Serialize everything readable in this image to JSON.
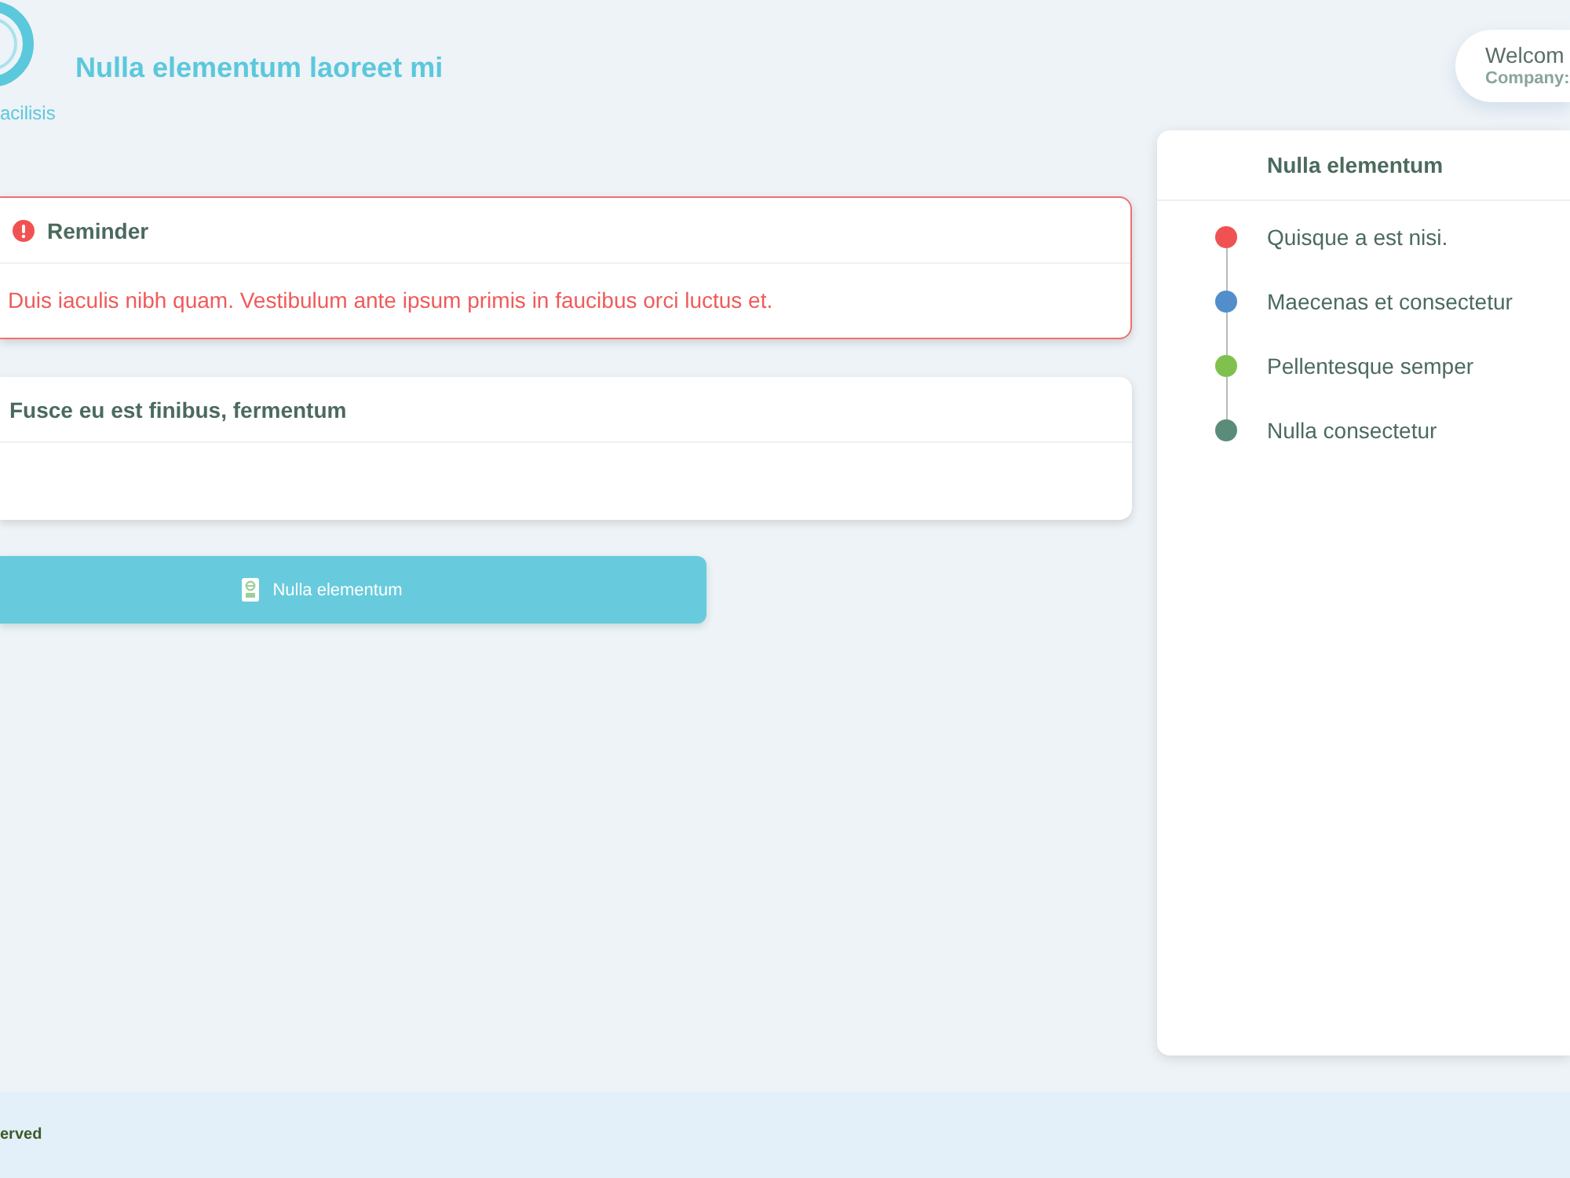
{
  "header": {
    "logo_caption": "acilisis",
    "title": "Nulla elementum laoreet mi",
    "user": {
      "greeting": "Welcom",
      "company": "Company:"
    }
  },
  "cards": [
    {
      "kind": "alert",
      "title": "Reminder",
      "body": "Duis iaculis nibh quam. Vestibulum ante ipsum primis in faucibus orci luctus et."
    },
    {
      "kind": "plain",
      "title": "Fusce eu est finibus, fermentum"
    }
  ],
  "action_button": {
    "label": "Nulla elementum"
  },
  "timeline": {
    "title": "Nulla elementum",
    "items": [
      {
        "label": "Quisque a est nisi.",
        "color": "#f05252"
      },
      {
        "label": "Maecenas et consectetur",
        "color": "#528ecb"
      },
      {
        "label": "Pellentesque semper",
        "color": "#80c04f"
      },
      {
        "label": "Nulla consectetur",
        "color": "#5b8c7a"
      }
    ]
  },
  "footer": {
    "text": "erved"
  }
}
